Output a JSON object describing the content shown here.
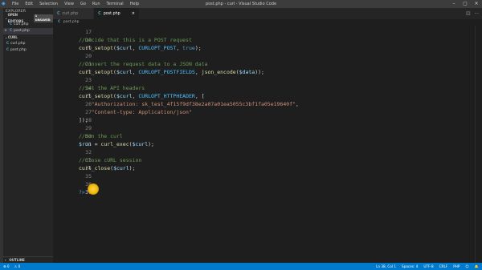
{
  "window": {
    "title": "post.php - curl - Visual Studio Code",
    "menu": [
      "File",
      "Edit",
      "Selection",
      "View",
      "Go",
      "Run",
      "Terminal",
      "Help"
    ]
  },
  "sidebar": {
    "section_title": "EXPLORER",
    "open_editors": {
      "label": "OPEN EDITORS",
      "badge": "1 UNSAVED",
      "files": [
        {
          "icon": "C",
          "name": "curl.php",
          "active": false
        },
        {
          "icon": "C",
          "name": "post.php",
          "active": true
        }
      ]
    },
    "folder": {
      "label": "CURL",
      "files": [
        {
          "icon": "C",
          "name": "curl.php"
        },
        {
          "icon": "C",
          "name": "post.php"
        }
      ]
    },
    "outline_label": "OUTLINE"
  },
  "tabs": [
    {
      "icon": "C",
      "name": "curl.php",
      "active": false
    },
    {
      "icon": "C",
      "name": "post.php",
      "active": true
    }
  ],
  "breadcrumb": {
    "icon": "C",
    "name": "post.php"
  },
  "editor": {
    "lines": [
      {
        "n": "17",
        "tokens": []
      },
      {
        "n": "18",
        "tokens": [
          {
            "t": "//Decide that this is a POST request",
            "c": "comment"
          }
        ]
      },
      {
        "n": "19",
        "tokens": [
          {
            "t": "curl_setopt",
            "c": "func"
          },
          {
            "t": "(",
            "c": "punc"
          },
          {
            "t": "$curl",
            "c": "var"
          },
          {
            "t": ", ",
            "c": "punc"
          },
          {
            "t": "CURLOPT_POST",
            "c": "const"
          },
          {
            "t": ", ",
            "c": "punc"
          },
          {
            "t": "true",
            "c": "bool"
          },
          {
            "t": ");",
            "c": "punc"
          }
        ]
      },
      {
        "n": "20",
        "tokens": []
      },
      {
        "n": "21",
        "tokens": [
          {
            "t": "//Convert the request data to a JSON data",
            "c": "comment"
          }
        ]
      },
      {
        "n": "22",
        "tokens": [
          {
            "t": "curl_setopt",
            "c": "func"
          },
          {
            "t": "(",
            "c": "punc"
          },
          {
            "t": "$curl",
            "c": "var"
          },
          {
            "t": ", ",
            "c": "punc"
          },
          {
            "t": "CURLOPT_POSTFIELDS",
            "c": "const"
          },
          {
            "t": ", ",
            "c": "punc"
          },
          {
            "t": "json_encode",
            "c": "func"
          },
          {
            "t": "(",
            "c": "punc"
          },
          {
            "t": "$data",
            "c": "var"
          },
          {
            "t": "));",
            "c": "punc"
          }
        ]
      },
      {
        "n": "23",
        "tokens": []
      },
      {
        "n": "24",
        "tokens": [
          {
            "t": "//Set the API headers",
            "c": "comment"
          }
        ]
      },
      {
        "n": "25",
        "tokens": [
          {
            "t": "curl_setopt",
            "c": "func"
          },
          {
            "t": "(",
            "c": "punc"
          },
          {
            "t": "$curl",
            "c": "var"
          },
          {
            "t": ", ",
            "c": "punc"
          },
          {
            "t": "CURLOPT_HTTPHEADER",
            "c": "const"
          },
          {
            "t": ", [",
            "c": "punc"
          }
        ]
      },
      {
        "n": "26",
        "tokens": [
          {
            "t": "    ",
            "c": "punc"
          },
          {
            "t": "\"Authorization: sk_test_4f15f9df38e2a07a01ea5055c3bf1fa05e19640f\"",
            "c": "str"
          },
          {
            "t": ",",
            "c": "punc"
          }
        ]
      },
      {
        "n": "27",
        "tokens": [
          {
            "t": "    ",
            "c": "punc"
          },
          {
            "t": "\"Content-type: Application/json\"",
            "c": "str"
          }
        ]
      },
      {
        "n": "28",
        "tokens": [
          {
            "t": "]);",
            "c": "punc"
          }
        ]
      },
      {
        "n": "29",
        "tokens": []
      },
      {
        "n": "30",
        "tokens": [
          {
            "t": "//Run the curl",
            "c": "comment"
          }
        ]
      },
      {
        "n": "31",
        "tokens": [
          {
            "t": "$run",
            "c": "var"
          },
          {
            "t": " = ",
            "c": "punc"
          },
          {
            "t": "curl_exec",
            "c": "func"
          },
          {
            "t": "(",
            "c": "punc"
          },
          {
            "t": "$curl",
            "c": "var"
          },
          {
            "t": ");",
            "c": "punc"
          }
        ]
      },
      {
        "n": "32",
        "tokens": []
      },
      {
        "n": "33",
        "tokens": [
          {
            "t": "//Close cURL session",
            "c": "comment"
          }
        ]
      },
      {
        "n": "34",
        "tokens": [
          {
            "t": "curl_close",
            "c": "func"
          },
          {
            "t": "(",
            "c": "punc"
          },
          {
            "t": "$curl",
            "c": "var"
          },
          {
            "t": ");",
            "c": "punc"
          }
        ]
      },
      {
        "n": "35",
        "tokens": []
      },
      {
        "n": "36",
        "tokens": []
      },
      {
        "n": "37",
        "tokens": [
          {
            "t": "?>",
            "c": "php"
          }
        ]
      }
    ]
  },
  "statusbar": {
    "left": [
      "⊗ 0",
      "⚠ 0"
    ],
    "right": [
      "Ln 38, Col 1",
      "Spaces: 4",
      "UTF-8",
      "CRLF",
      "PHP",
      "☺",
      "🔔"
    ]
  },
  "colors": {
    "accent": "#007acc",
    "comment": "#6a9955",
    "string": "#ce9178",
    "function": "#dcdcaa",
    "variable": "#9cdcfe",
    "cursor_highlight": "#f2b705"
  }
}
